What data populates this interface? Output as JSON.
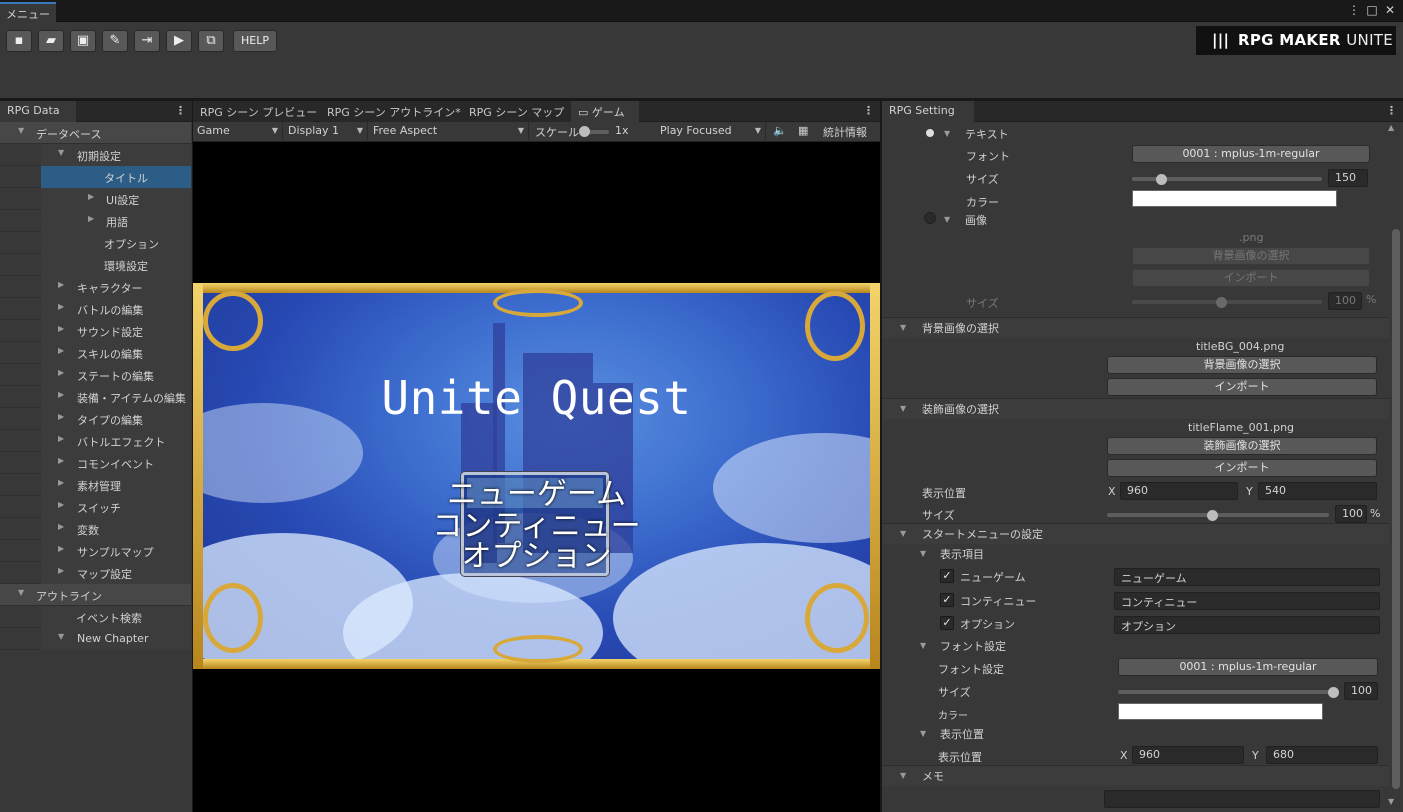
{
  "window": {
    "menu_tab": "メニュー",
    "controls": [
      "⋮",
      "□",
      "✕"
    ]
  },
  "toolbar": {
    "icons": [
      "new-project-icon",
      "open-project-icon",
      "save-icon",
      "edit-icon",
      "export-icon",
      "play-icon",
      "addon-icon"
    ],
    "help_label": "HELP",
    "logo_text": "RPG MAKER ",
    "logo_text_thin": "UNITE"
  },
  "left_panel": {
    "tab": "RPG Data",
    "items": [
      {
        "label": "データベース",
        "level": 0,
        "arrow": "▼",
        "kind": "section"
      },
      {
        "label": "初期設定",
        "level": 1,
        "arrow": "▼",
        "kind": "item"
      },
      {
        "label": "タイトル",
        "level": 2,
        "arrow": "",
        "kind": "selected"
      },
      {
        "label": "UI設定",
        "level": 2,
        "arrow": "▶",
        "kind": "item"
      },
      {
        "label": "用語",
        "level": 2,
        "arrow": "▶",
        "kind": "item"
      },
      {
        "label": "オプション",
        "level": 2,
        "arrow": "",
        "kind": "item"
      },
      {
        "label": "環境設定",
        "level": 2,
        "arrow": "",
        "kind": "item"
      },
      {
        "label": "キャラクター",
        "level": 1,
        "arrow": "▶",
        "kind": "item"
      },
      {
        "label": "バトルの編集",
        "level": 1,
        "arrow": "▶",
        "kind": "item"
      },
      {
        "label": "サウンド設定",
        "level": 1,
        "arrow": "▶",
        "kind": "item"
      },
      {
        "label": "スキルの編集",
        "level": 1,
        "arrow": "▶",
        "kind": "item"
      },
      {
        "label": "ステートの編集",
        "level": 1,
        "arrow": "▶",
        "kind": "item"
      },
      {
        "label": "装備・アイテムの編集",
        "level": 1,
        "arrow": "▶",
        "kind": "item"
      },
      {
        "label": "タイプの編集",
        "level": 1,
        "arrow": "▶",
        "kind": "item"
      },
      {
        "label": "バトルエフェクト",
        "level": 1,
        "arrow": "▶",
        "kind": "item"
      },
      {
        "label": "コモンイベント",
        "level": 1,
        "arrow": "▶",
        "kind": "item"
      },
      {
        "label": "素材管理",
        "level": 1,
        "arrow": "▶",
        "kind": "item"
      },
      {
        "label": "スイッチ",
        "level": 1,
        "arrow": "▶",
        "kind": "item"
      },
      {
        "label": "変数",
        "level": 1,
        "arrow": "▶",
        "kind": "item"
      },
      {
        "label": "サンプルマップ",
        "level": 1,
        "arrow": "▶",
        "kind": "item"
      },
      {
        "label": "マップ設定",
        "level": 1,
        "arrow": "▶",
        "kind": "item"
      },
      {
        "label": "アウトライン",
        "level": 0,
        "arrow": "▼",
        "kind": "section"
      },
      {
        "label": "イベント検索",
        "level": 1.5,
        "arrow": "",
        "kind": "item"
      },
      {
        "label": "New Chapter",
        "level": 1,
        "arrow": "▼",
        "kind": "item"
      }
    ]
  },
  "center_panel": {
    "tabs": [
      "RPG シーン プレビュー",
      "RPG シーン アウトライン*",
      "RPG シーン マップ",
      "ゲーム"
    ],
    "active_tab": "ゲーム",
    "game_toolbar": {
      "view": "Game",
      "display": "Display 1",
      "aspect": "Free Aspect",
      "scale_label": "スケール",
      "scale_value": "1x",
      "play_mode": "Play Focused",
      "stats": "統計情報"
    },
    "game": {
      "title": "Unite Quest",
      "menu": [
        "ニューゲーム",
        "コンティニュー",
        "オプション"
      ]
    }
  },
  "right_panel": {
    "tab": "RPG Setting",
    "text_section": {
      "label": "テキスト",
      "font_label": "フォント",
      "font_value": "0001 : mplus-1m-regular",
      "size_label": "サイズ",
      "size_value": "150",
      "color_label": "カラー",
      "color_value": "#ffffff"
    },
    "image_section": {
      "label": "画像",
      "file": ".png",
      "select_btn": "背景画像の選択",
      "import_btn": "インポート",
      "size_label": "サイズ",
      "size_value": "100",
      "unit": "%"
    },
    "bg_section": {
      "label": "背景画像の選択",
      "file": "titleBG_004.png",
      "select_btn": "背景画像の選択",
      "import_btn": "インポート"
    },
    "deco_section": {
      "label": "装飾画像の選択",
      "file": "titleFlame_001.png",
      "select_btn": "装飾画像の選択",
      "import_btn": "インポート",
      "pos_label": "表示位置",
      "x_label": "X",
      "x_value": "960",
      "y_label": "Y",
      "y_value": "540",
      "size_label": "サイズ",
      "size_value": "100",
      "unit": "%"
    },
    "start_menu": {
      "label": "スタートメニューの設定",
      "items_label": "表示項目",
      "items": [
        {
          "label": "ニューゲーム",
          "value": "ニューゲーム"
        },
        {
          "label": "コンティニュー",
          "value": "コンティニュー"
        },
        {
          "label": "オプション",
          "value": "オプション"
        }
      ],
      "font_section_label": "フォント設定",
      "font_label": "フォント設定",
      "font_value": "0001 : mplus-1m-regular",
      "size_label": "サイズ",
      "size_value": "100",
      "color_label": "カラー",
      "color_value": "#ffffff",
      "pos_section_label": "表示位置",
      "pos_label": "表示位置",
      "x_label": "X",
      "x_value": "960",
      "y_label": "Y",
      "y_value": "680"
    },
    "memo_label": "メモ"
  },
  "colors": {
    "accent": "#3a79bb",
    "selected": "#2c5d87",
    "panel": "#383838",
    "frame_gold": "#d8a93a"
  }
}
